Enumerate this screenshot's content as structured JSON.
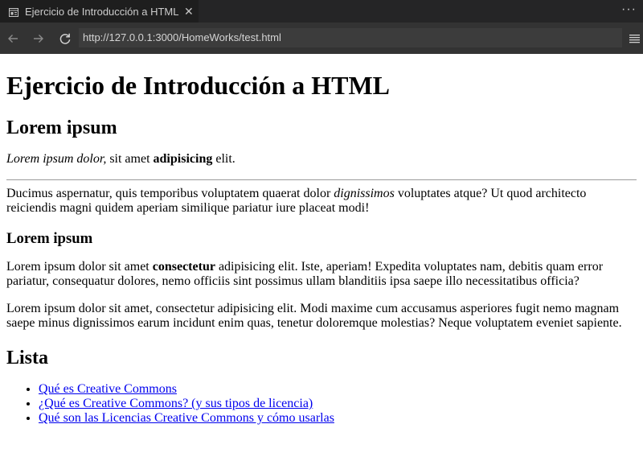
{
  "tab": {
    "title": "Ejercicio de Introducción a HTML",
    "close_symbol": "✕",
    "more_symbol": "···"
  },
  "address": {
    "url": "http://127.0.0.1:3000/HomeWorks/test.html"
  },
  "content": {
    "h1": "Ejercicio de Introducción a HTML",
    "section1": {
      "heading": "Lorem ipsum",
      "p1": {
        "em": "Lorem ipsum dolor,",
        "mid": " sit amet ",
        "strong": "adipisicing",
        "end": " elit."
      },
      "p2": {
        "start": "Ducimus aspernatur, quis temporibus voluptatem quaerat dolor ",
        "em": "dignissimos",
        "end": " voluptates atque? Ut quod architecto reiciendis magni quidem aperiam similique pariatur iure placeat modi!"
      }
    },
    "section2": {
      "heading": "Lorem ipsum",
      "p1": {
        "start": "Lorem ipsum dolor sit amet ",
        "strong": "consectetur",
        "end": " adipisicing elit. Iste, aperiam! Expedita voluptates nam, debitis quam error pariatur, consequatur dolores, nemo officiis sint possimus ullam blanditiis ipsa saepe illo necessitatibus officia?"
      },
      "p2": "Lorem ipsum dolor sit amet, consectetur adipisicing elit. Modi maxime cum accusamus asperiores fugit nemo magnam saepe minus dignissimos earum incidunt enim quas, tenetur doloremque molestias? Neque voluptatem eveniet sapiente."
    },
    "list": {
      "heading": "Lista",
      "items": [
        "Qué es Creative Commons",
        "¿Qué es Creative Commons? (y sus tipos de licencia)",
        "Qué son las Licencias Creative Commons y cómo usarlas"
      ]
    }
  }
}
